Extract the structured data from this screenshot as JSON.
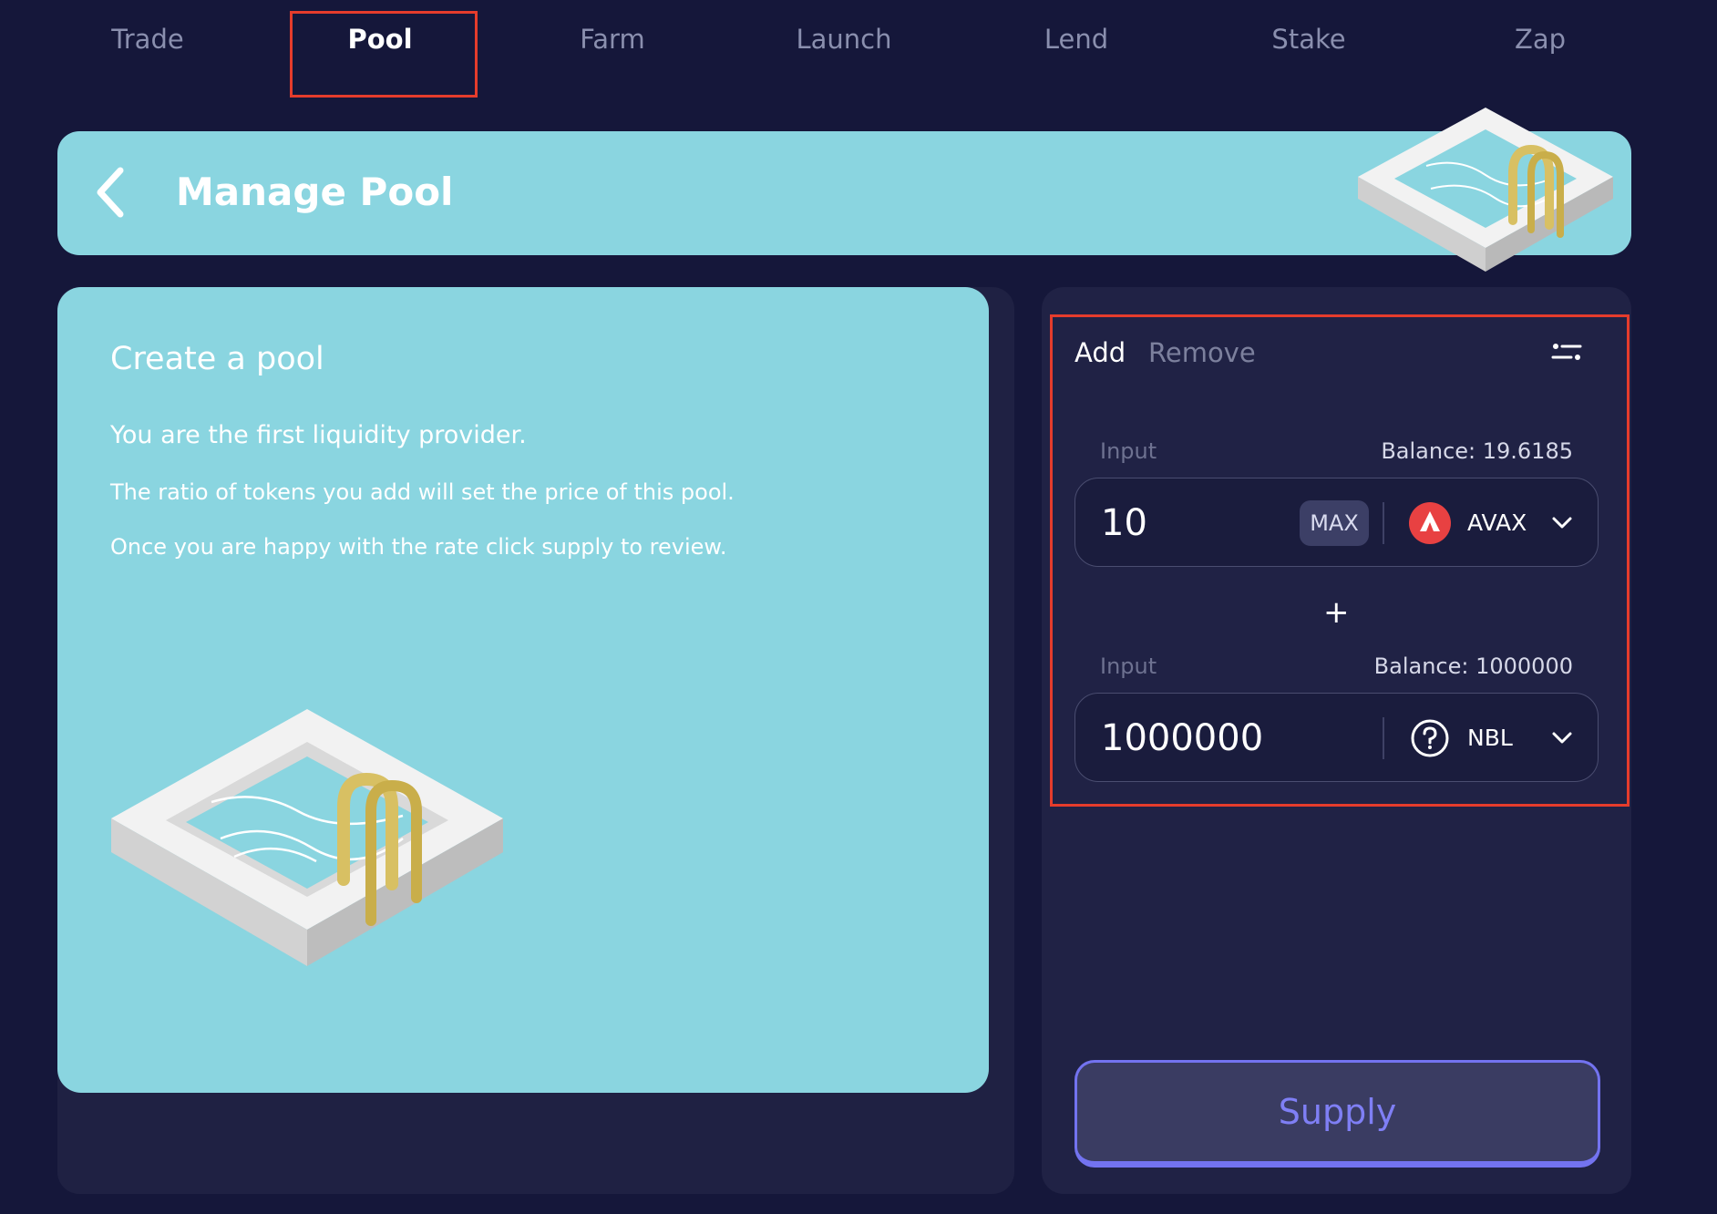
{
  "nav": {
    "items": [
      {
        "label": "Trade"
      },
      {
        "label": "Pool",
        "active": true
      },
      {
        "label": "Farm"
      },
      {
        "label": "Launch"
      },
      {
        "label": "Lend"
      },
      {
        "label": "Stake"
      },
      {
        "label": "Zap"
      }
    ]
  },
  "header": {
    "title": "Manage Pool",
    "back_icon": "chevron-left-icon",
    "art_icon": "pool-illustration"
  },
  "info": {
    "title": "Create a pool",
    "line1": "You are the first liquidity provider.",
    "line2": "The ratio of tokens you add will set the price of this pool.",
    "line3": "Once you are happy with the rate click supply to review."
  },
  "liquidity": {
    "tabs": {
      "add": "Add",
      "remove": "Remove"
    },
    "settings_icon": "sliders-icon",
    "input1": {
      "label": "Input",
      "balance": "Balance: 19.6185",
      "amount": "10",
      "max_label": "MAX",
      "token": "AVAX",
      "token_icon": "avax-icon"
    },
    "plus": "+",
    "input2": {
      "label": "Input",
      "balance": "Balance: 1000000",
      "amount": "1000000",
      "token": "NBL",
      "token_icon": "question-circle-icon"
    },
    "supply_label": "Supply"
  },
  "colors": {
    "background": "#15173a",
    "panel": "#202245",
    "accent_cyan": "#8ad5e0",
    "highlight_red": "#e53c2c",
    "supply_purple": "#7373f0",
    "avax_red": "#e84142"
  }
}
